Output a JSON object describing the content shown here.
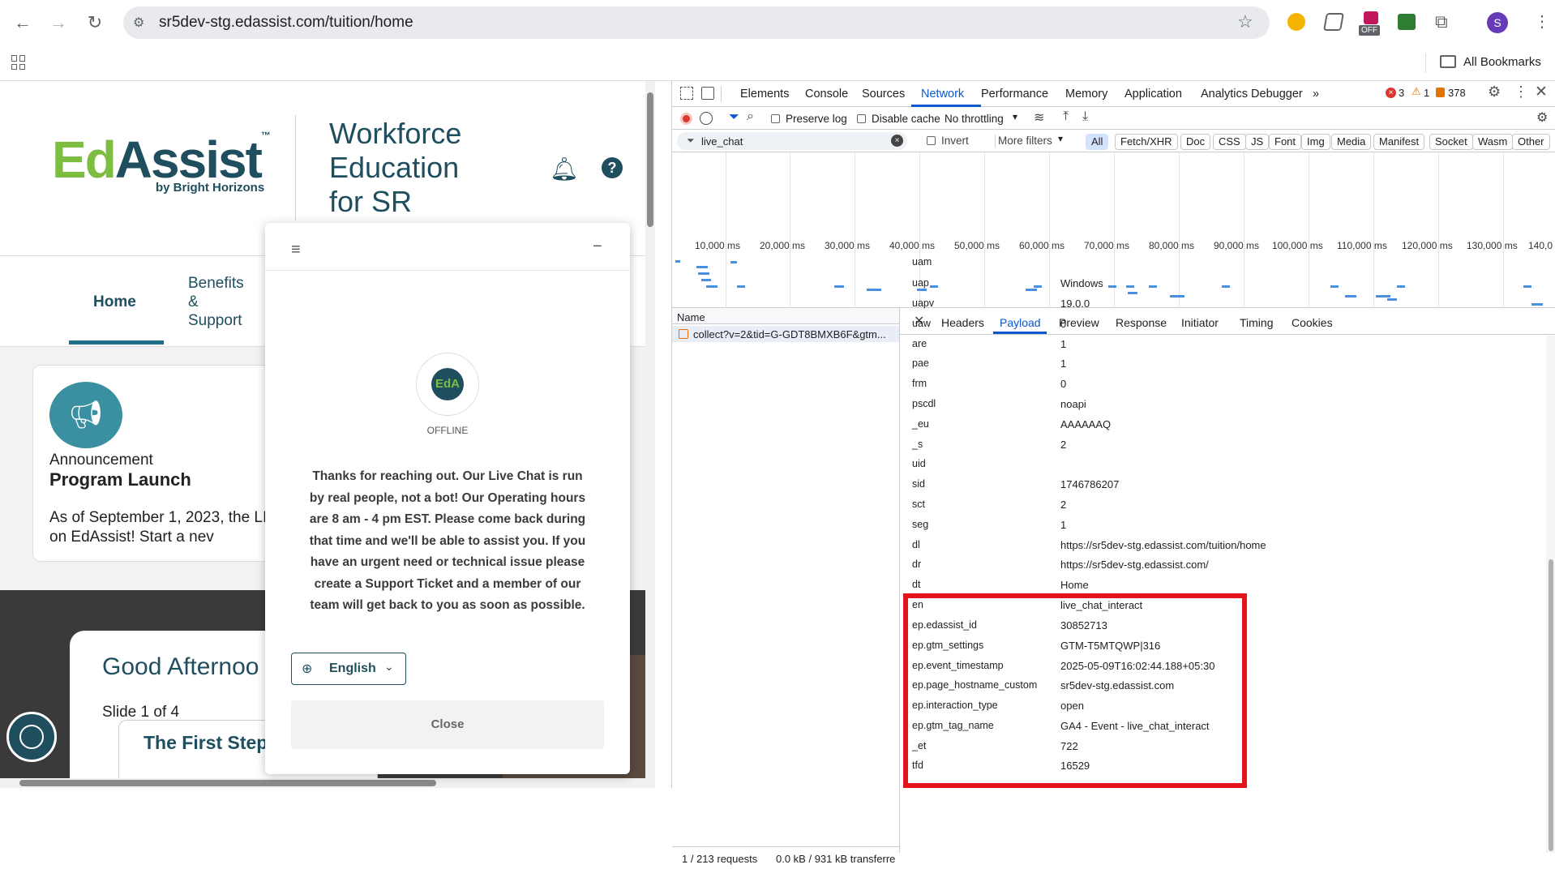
{
  "browser": {
    "url": "sr5dev-stg.edassist.com/tuition/home",
    "bookmarks_label": "All Bookmarks",
    "extension_off_badge": "OFF",
    "profile_initial": "S"
  },
  "page": {
    "logo_text_ed": "Ed",
    "logo_text_assist": "Assist",
    "logo_tm": "™",
    "logo_byline": "by Bright Horizons",
    "title": "Workforce Education for SR",
    "nav": [
      {
        "label": "Home"
      },
      {
        "label": "Benefits & Support"
      }
    ],
    "announcement": {
      "type": "Announcement",
      "title": "Program Launch",
      "body": "As of September 1, 2023, the LIVE on EdAssist! Start a nev"
    },
    "greeting": "Good Afternoo",
    "slide_indicator": "Slide 1 of 4",
    "slide_title": "The First Step"
  },
  "chat": {
    "avatar_text": "EdA",
    "status": "OFFLINE",
    "message": "Thanks for reaching out. Our Live Chat is run by real people, not a bot! Our Operating hours are 8 am - 4 pm EST. Please come back during that time and we'll be able to assist you. If you have an urgent need or technical issue please create a Support Ticket and a member of our team will get back to you as soon as possible.",
    "language": "English",
    "close_label": "Close"
  },
  "devtools": {
    "tabs": [
      "Elements",
      "Console",
      "Sources",
      "Network",
      "Performance",
      "Memory",
      "Application",
      "Analytics Debugger"
    ],
    "active_tab": "Network",
    "errors": "3",
    "warnings": "1",
    "issues": "378",
    "preserve_log": "Preserve log",
    "disable_cache": "Disable cache",
    "throttling": "No throttling",
    "filter_value": "live_chat",
    "invert": "Invert",
    "more_filters": "More filters",
    "type_filters": [
      "All",
      "Fetch/XHR",
      "Doc",
      "CSS",
      "JS",
      "Font",
      "Img",
      "Media",
      "Manifest",
      "Socket",
      "Wasm",
      "Other"
    ],
    "timeline_ticks": [
      "10,000 ms",
      "20,000 ms",
      "30,000 ms",
      "40,000 ms",
      "50,000 ms",
      "60,000 ms",
      "70,000 ms",
      "80,000 ms",
      "90,000 ms",
      "100,000 ms",
      "110,000 ms",
      "120,000 ms",
      "130,000 ms",
      "140,0"
    ],
    "name_header": "Name",
    "request_name": "collect?v=2&tid=G-GDT8BMXB6F&gtm...",
    "detail_tabs": [
      "Headers",
      "Payload",
      "Preview",
      "Response",
      "Initiator",
      "Timing",
      "Cookies"
    ],
    "active_detail_tab": "Payload",
    "payload": [
      {
        "key": "uam",
        "value": ""
      },
      {
        "key": "uap",
        "value": "Windows"
      },
      {
        "key": "uapv",
        "value": "19.0.0"
      },
      {
        "key": "uaw",
        "value": "0"
      },
      {
        "key": "are",
        "value": "1"
      },
      {
        "key": "pae",
        "value": "1"
      },
      {
        "key": "frm",
        "value": "0"
      },
      {
        "key": "pscdl",
        "value": "noapi"
      },
      {
        "key": "_eu",
        "value": "AAAAAAQ"
      },
      {
        "key": "_s",
        "value": "2"
      },
      {
        "key": "uid",
        "value": ""
      },
      {
        "key": "sid",
        "value": "1746786207"
      },
      {
        "key": "sct",
        "value": "2"
      },
      {
        "key": "seg",
        "value": "1"
      },
      {
        "key": "dl",
        "value": "https://sr5dev-stg.edassist.com/tuition/home"
      },
      {
        "key": "dr",
        "value": "https://sr5dev-stg.edassist.com/"
      },
      {
        "key": "dt",
        "value": "Home"
      },
      {
        "key": "en",
        "value": "live_chat_interact"
      },
      {
        "key": "ep.edassist_id",
        "value": "30852713"
      },
      {
        "key": "ep.gtm_settings",
        "value": "GTM-T5MTQWP|316"
      },
      {
        "key": "ep.event_timestamp",
        "value": "2025-05-09T16:02:44.188+05:30"
      },
      {
        "key": "ep.page_hostname_custom",
        "value": "sr5dev-stg.edassist.com"
      },
      {
        "key": "ep.interaction_type",
        "value": "open"
      },
      {
        "key": "ep.gtm_tag_name",
        "value": "GA4 - Event - live_chat_interact"
      },
      {
        "key": "_et",
        "value": "722"
      },
      {
        "key": "tfd",
        "value": "16529"
      }
    ],
    "status_requests": "1 / 213 requests",
    "status_transfer": "0.0 kB / 931 kB transferre",
    "highlight_color": "#e3141b"
  }
}
